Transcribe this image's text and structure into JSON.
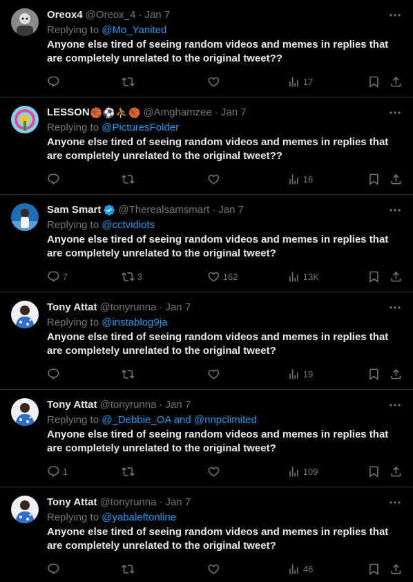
{
  "tweets": [
    {
      "name": "Oreox4",
      "emojis": [],
      "verified": false,
      "handle": "@Oreox_4",
      "date": "Jan 7",
      "replying_prefix": "Replying to",
      "mentions": "@Mo_Yanited",
      "text": "Anyone else tired of seeing random videos and memes in replies that are completely unrelated to the original tweet??",
      "replies": "",
      "retweets": "",
      "likes": "",
      "views": "17"
    },
    {
      "name": "LESSON",
      "emojis": [
        "🏀",
        "⚽",
        "⛹",
        "🏀"
      ],
      "verified": false,
      "handle": "@Amghamzee",
      "date": "Jan 7",
      "replying_prefix": "Replying to",
      "mentions": "@PicturesFolder",
      "text": "Anyone else tired of seeing random videos and memes in replies that are completely unrelated to the original tweet??",
      "replies": "",
      "retweets": "",
      "likes": "",
      "views": "16"
    },
    {
      "name": "Sam Smart",
      "emojis": [],
      "verified": true,
      "handle": "@Therealsamsmart",
      "date": "Jan 7",
      "replying_prefix": "Replying to",
      "mentions": "@cctvidiots",
      "text": "Anyone else tired of seeing random videos and memes in replies that are completely unrelated to the original tweet?",
      "replies": "7",
      "retweets": "3",
      "likes": "162",
      "views": "13K"
    },
    {
      "name": "Tony Attat",
      "emojis": [],
      "verified": false,
      "handle": "@tonyrunna",
      "date": "Jan 7",
      "replying_prefix": "Replying to",
      "mentions": "@instablog9ja",
      "text": "Anyone else tired of seeing random videos and memes in replies that are completely unrelated to the original tweet?",
      "replies": "",
      "retweets": "",
      "likes": "",
      "views": "19"
    },
    {
      "name": "Tony Attat",
      "emojis": [],
      "verified": false,
      "handle": "@tonyrunna",
      "date": "Jan 7",
      "replying_prefix": "Replying to",
      "mentions": "@_Debbie_OA and @nnpclimited",
      "text": "Anyone else tired of seeing random videos and memes in replies that are completely unrelated to the original tweet?",
      "replies": "1",
      "retweets": "",
      "likes": "",
      "views": "109"
    },
    {
      "name": "Tony Attat",
      "emojis": [],
      "verified": false,
      "handle": "@tonyrunna",
      "date": "Jan 7",
      "replying_prefix": "Replying to",
      "mentions": "@yabaleftonline",
      "text": "Anyone else tired of seeing random videos and memes in replies that are completely unrelated to the original tweet?",
      "replies": "",
      "retweets": "",
      "likes": "",
      "views": "46"
    }
  ],
  "colors": {
    "background": "#000000",
    "text_primary": "#e7e9ea",
    "text_secondary": "#71767b",
    "link": "#1d9bf0",
    "divider": "#2f3336"
  }
}
